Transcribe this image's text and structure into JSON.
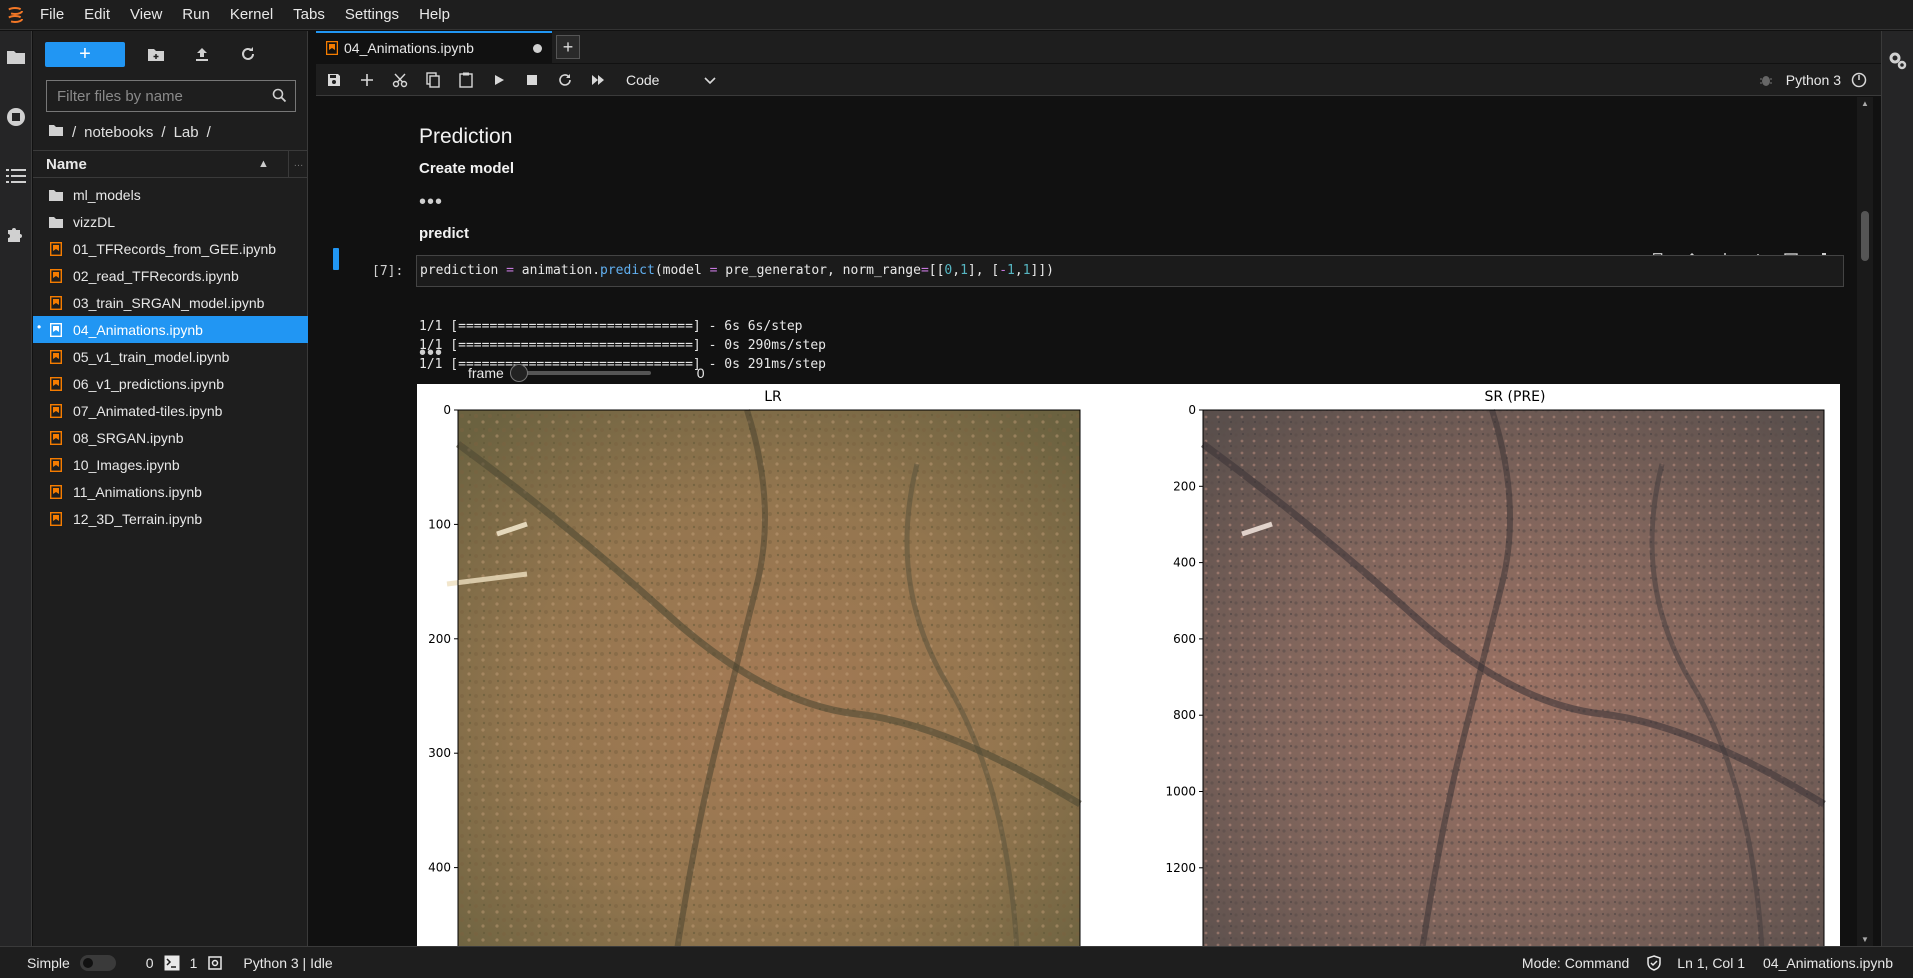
{
  "menubar": {
    "items": [
      "File",
      "Edit",
      "View",
      "Run",
      "Kernel",
      "Tabs",
      "Settings",
      "Help"
    ]
  },
  "filebrowser": {
    "filter_placeholder": "Filter files by name",
    "breadcrumb": [
      "/",
      "notebooks",
      "/",
      "Lab",
      "/"
    ],
    "header_name": "Name",
    "files": [
      {
        "name": "ml_models",
        "type": "folder"
      },
      {
        "name": "vizzDL",
        "type": "folder"
      },
      {
        "name": "01_TFRecords_from_GEE.ipynb",
        "type": "notebook"
      },
      {
        "name": "02_read_TFRecords.ipynb",
        "type": "notebook"
      },
      {
        "name": "03_train_SRGAN_model.ipynb",
        "type": "notebook"
      },
      {
        "name": "04_Animations.ipynb",
        "type": "notebook",
        "selected": true
      },
      {
        "name": "05_v1_train_model.ipynb",
        "type": "notebook"
      },
      {
        "name": "06_v1_predictions.ipynb",
        "type": "notebook"
      },
      {
        "name": "07_Animated-tiles.ipynb",
        "type": "notebook"
      },
      {
        "name": "08_SRGAN.ipynb",
        "type": "notebook"
      },
      {
        "name": "10_Images.ipynb",
        "type": "notebook"
      },
      {
        "name": "11_Animations.ipynb",
        "type": "notebook"
      },
      {
        "name": "12_3D_Terrain.ipynb",
        "type": "notebook"
      }
    ]
  },
  "tab": {
    "title": "04_Animations.ipynb",
    "add_label": "+"
  },
  "toolbar": {
    "cell_type": "Code",
    "kernel_name": "Python 3"
  },
  "notebook": {
    "heading": "Prediction",
    "subheading_create": "Create model",
    "ellipsis1": "•••",
    "subheading_predict": "predict",
    "prompt": "[7]:",
    "code_parts": {
      "a": "prediction ",
      "eq1": "=",
      "b": " animation.",
      "fn": "predict",
      "c": "(model ",
      "eq2": "=",
      "d": " pre_generator, norm_range",
      "eq3": "=",
      "e": "[[",
      "n0": "0",
      "comma1": ",",
      "n1": "1",
      "f": "], [",
      "minus": "-",
      "n2": "1",
      "comma2": ",",
      "n3": "1",
      "g": "]])"
    },
    "output_lines": [
      "1/1 [==============================] - 6s 6s/step",
      "1/1 [==============================] - 0s 290ms/step",
      "1/1 [==============================] - 0s 291ms/step"
    ],
    "ellipsis2": "•••",
    "slider_label": "frame",
    "slider_value": "0",
    "slider_fraction": 0
  },
  "figure": {
    "left_title": "LR",
    "right_title": "SR (PRE)",
    "left_ticks": [
      "0",
      "100",
      "200",
      "300",
      "400"
    ],
    "right_ticks": [
      "0",
      "200",
      "400",
      "600",
      "800",
      "1000",
      "1200"
    ]
  },
  "statusbar": {
    "mode_label": "Simple",
    "count_a": "0",
    "count_b": "1",
    "kernel_status": "Python 3 | Idle",
    "mode": "Mode: Command",
    "position": "Ln 1, Col 1",
    "filename": "04_Animations.ipynb"
  },
  "colors": {
    "accent": "#2196f3",
    "notebook_icon": "#f57c00"
  }
}
